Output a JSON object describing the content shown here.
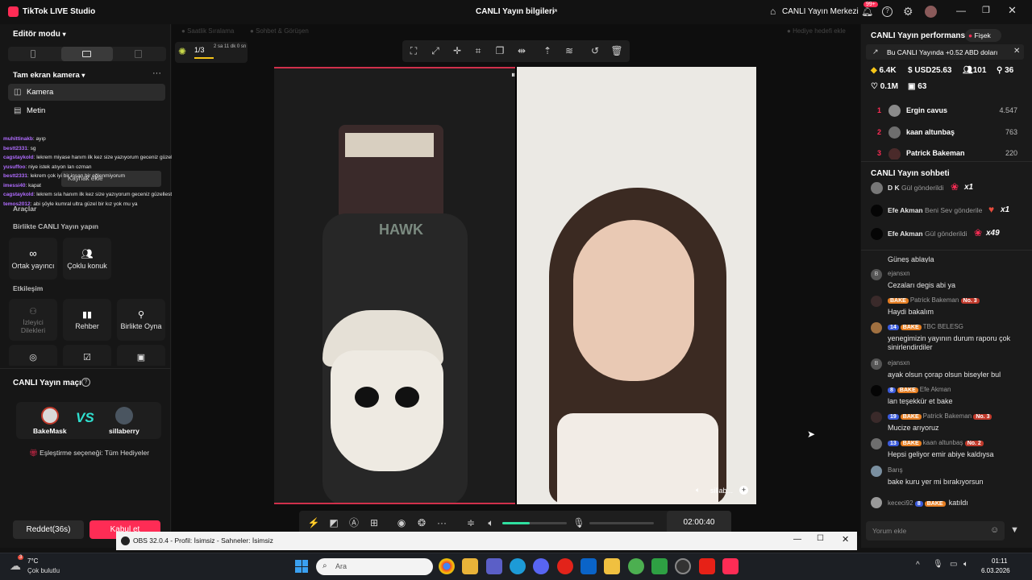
{
  "app": {
    "title": "TikTok LIVE Studio",
    "center_title": "CANLI Yayın bilgileri",
    "live_center": "CANLI Yayın Merkezi",
    "notif_count": "99+"
  },
  "left": {
    "editor_mode": "Editör modu",
    "scene": "Tam ekran kamera",
    "sources": [
      "Kamera",
      "Metin"
    ],
    "tooltip": "Kaynak ekle",
    "tools_header": "Araçlar",
    "live_together_header": "Birlikte CANLI Yayın yapın",
    "cohost": "Ortak yayıncı",
    "multi_guest": "Çoklu konuk",
    "interaction_header": "Etkileşim",
    "viewer_requests": "İzleyici Dilekleri",
    "guide": "Rehber",
    "play_together": "Birlikte Oyna",
    "match_header": "CANLI Yayın maçı",
    "player1": "BakeMask",
    "player2": "sillaberry",
    "match_option": "Eşleştirme seçeneği: Tüm Hediyeler",
    "decline": "Reddet(36s)",
    "accept": "Kabul et"
  },
  "overlay_chat": [
    {
      "name": "muhittinakb",
      "text": ": ayıp"
    },
    {
      "name": "bestt2331",
      "text": ": sg"
    },
    {
      "name": "cagstaykold",
      "text": ": lekrem miyase hanım ilk kez size yazıyorum geceniz güzel olsun ben çağo"
    },
    {
      "name": "yusuffoo",
      "text": ": niye istek atıyon lan ozman"
    },
    {
      "name": "bestt2331",
      "text": ": lekrem çok iyi bir insan bir eğlenmiyorum"
    },
    {
      "name": "imessi40",
      "text": ": kapat"
    },
    {
      "name": "cagstaykold",
      "text": ": lekrem sıla hanım ilk kez size yazıyorum geceniz güzellestirdiniz ben Çağo"
    },
    {
      "name": "temos2012",
      "text": ": abi şöyle kumral ultra güzel bir kız yok mu ya"
    }
  ],
  "top_strip": {
    "item1": "Saatlik Sıralama",
    "item2": "Sohbet & Görüşen",
    "gift_hint": "Hediye hedefi ekle",
    "goal": "1/3",
    "goal_time": "2 sa 11 dk 0 sn"
  },
  "video": {
    "guest_label": "sillab...",
    "timer": "02:00:40",
    "volume_level": 0.42
  },
  "right": {
    "perf_title": "CANLI Yayın performansı",
    "firecracker": "Fişek",
    "earning_note": "Bu CANLI Yayında +0.52 ABD doları",
    "stats": {
      "coins": "6.4K",
      "usd": "USD25.63",
      "viewers": "101",
      "new": "36",
      "likes": "0.1M",
      "gifts": "63"
    },
    "ranking": [
      {
        "rank": "1",
        "name": "Ergin cavus",
        "score": "4.547"
      },
      {
        "rank": "2",
        "name": "kaan altunbaş",
        "score": "763"
      },
      {
        "rank": "3",
        "name": "Patrick Bakeman",
        "score": "220"
      }
    ],
    "chat_title": "CANLI Yayın sohbeti",
    "gift_events": [
      {
        "name": "D K",
        "text": "Gül gönderildi",
        "count": "x1"
      },
      {
        "name": "Efe Akman",
        "text": "Beni Sev gönderile",
        "count": "x1"
      },
      {
        "name": "Efe Akman",
        "text": "Gül gönderildi",
        "count": "x49"
      }
    ],
    "messages": [
      {
        "user": "",
        "text": "Güneş ablayla"
      },
      {
        "user": "ejansxn",
        "text": "Cezaları degis abi ya"
      },
      {
        "user": "Patrick Bakeman",
        "badges": [
          "BAKE",
          "No. 3"
        ],
        "text": "Haydi bakalım"
      },
      {
        "user": "TBC BELESG",
        "badges": [
          "14",
          "BAKE"
        ],
        "text": "yenegimizin yayının durum raporu çok sinirlendirdiler"
      },
      {
        "user": "ejansxn",
        "text": "ayak olsun çorap olsun biseyler bul"
      },
      {
        "user": "Efe Akman",
        "badges": [
          "8",
          "BAKE"
        ],
        "text": "lan teşekkür et bake"
      },
      {
        "user": "Patrick Bakeman",
        "badges": [
          "19",
          "BAKE",
          "No. 3"
        ],
        "text": "Mucize arıyoruz"
      },
      {
        "user": "kaan altunbaş",
        "badges": [
          "13",
          "BAKE",
          "No. 2"
        ],
        "text": "Hepsi geliyor emir abiye kaldıysa"
      },
      {
        "user": "Barış",
        "text": "bake kuru yer mi bırakıyorsun"
      },
      {
        "user": "kececi92",
        "badges": [
          "8",
          "BAKE"
        ],
        "text": "katıldı"
      }
    ],
    "comment_placeholder": "Yorum ekle"
  },
  "obs": {
    "title": "OBS 32.0.4 - Profil: İsimsiz - Sahneler: İsimsiz"
  },
  "taskbar": {
    "temp": "7°C",
    "weather": "Çok bulutlu",
    "search": "Ara",
    "time": "01:11",
    "date": "6.03.2026",
    "weather_badge": "3"
  }
}
